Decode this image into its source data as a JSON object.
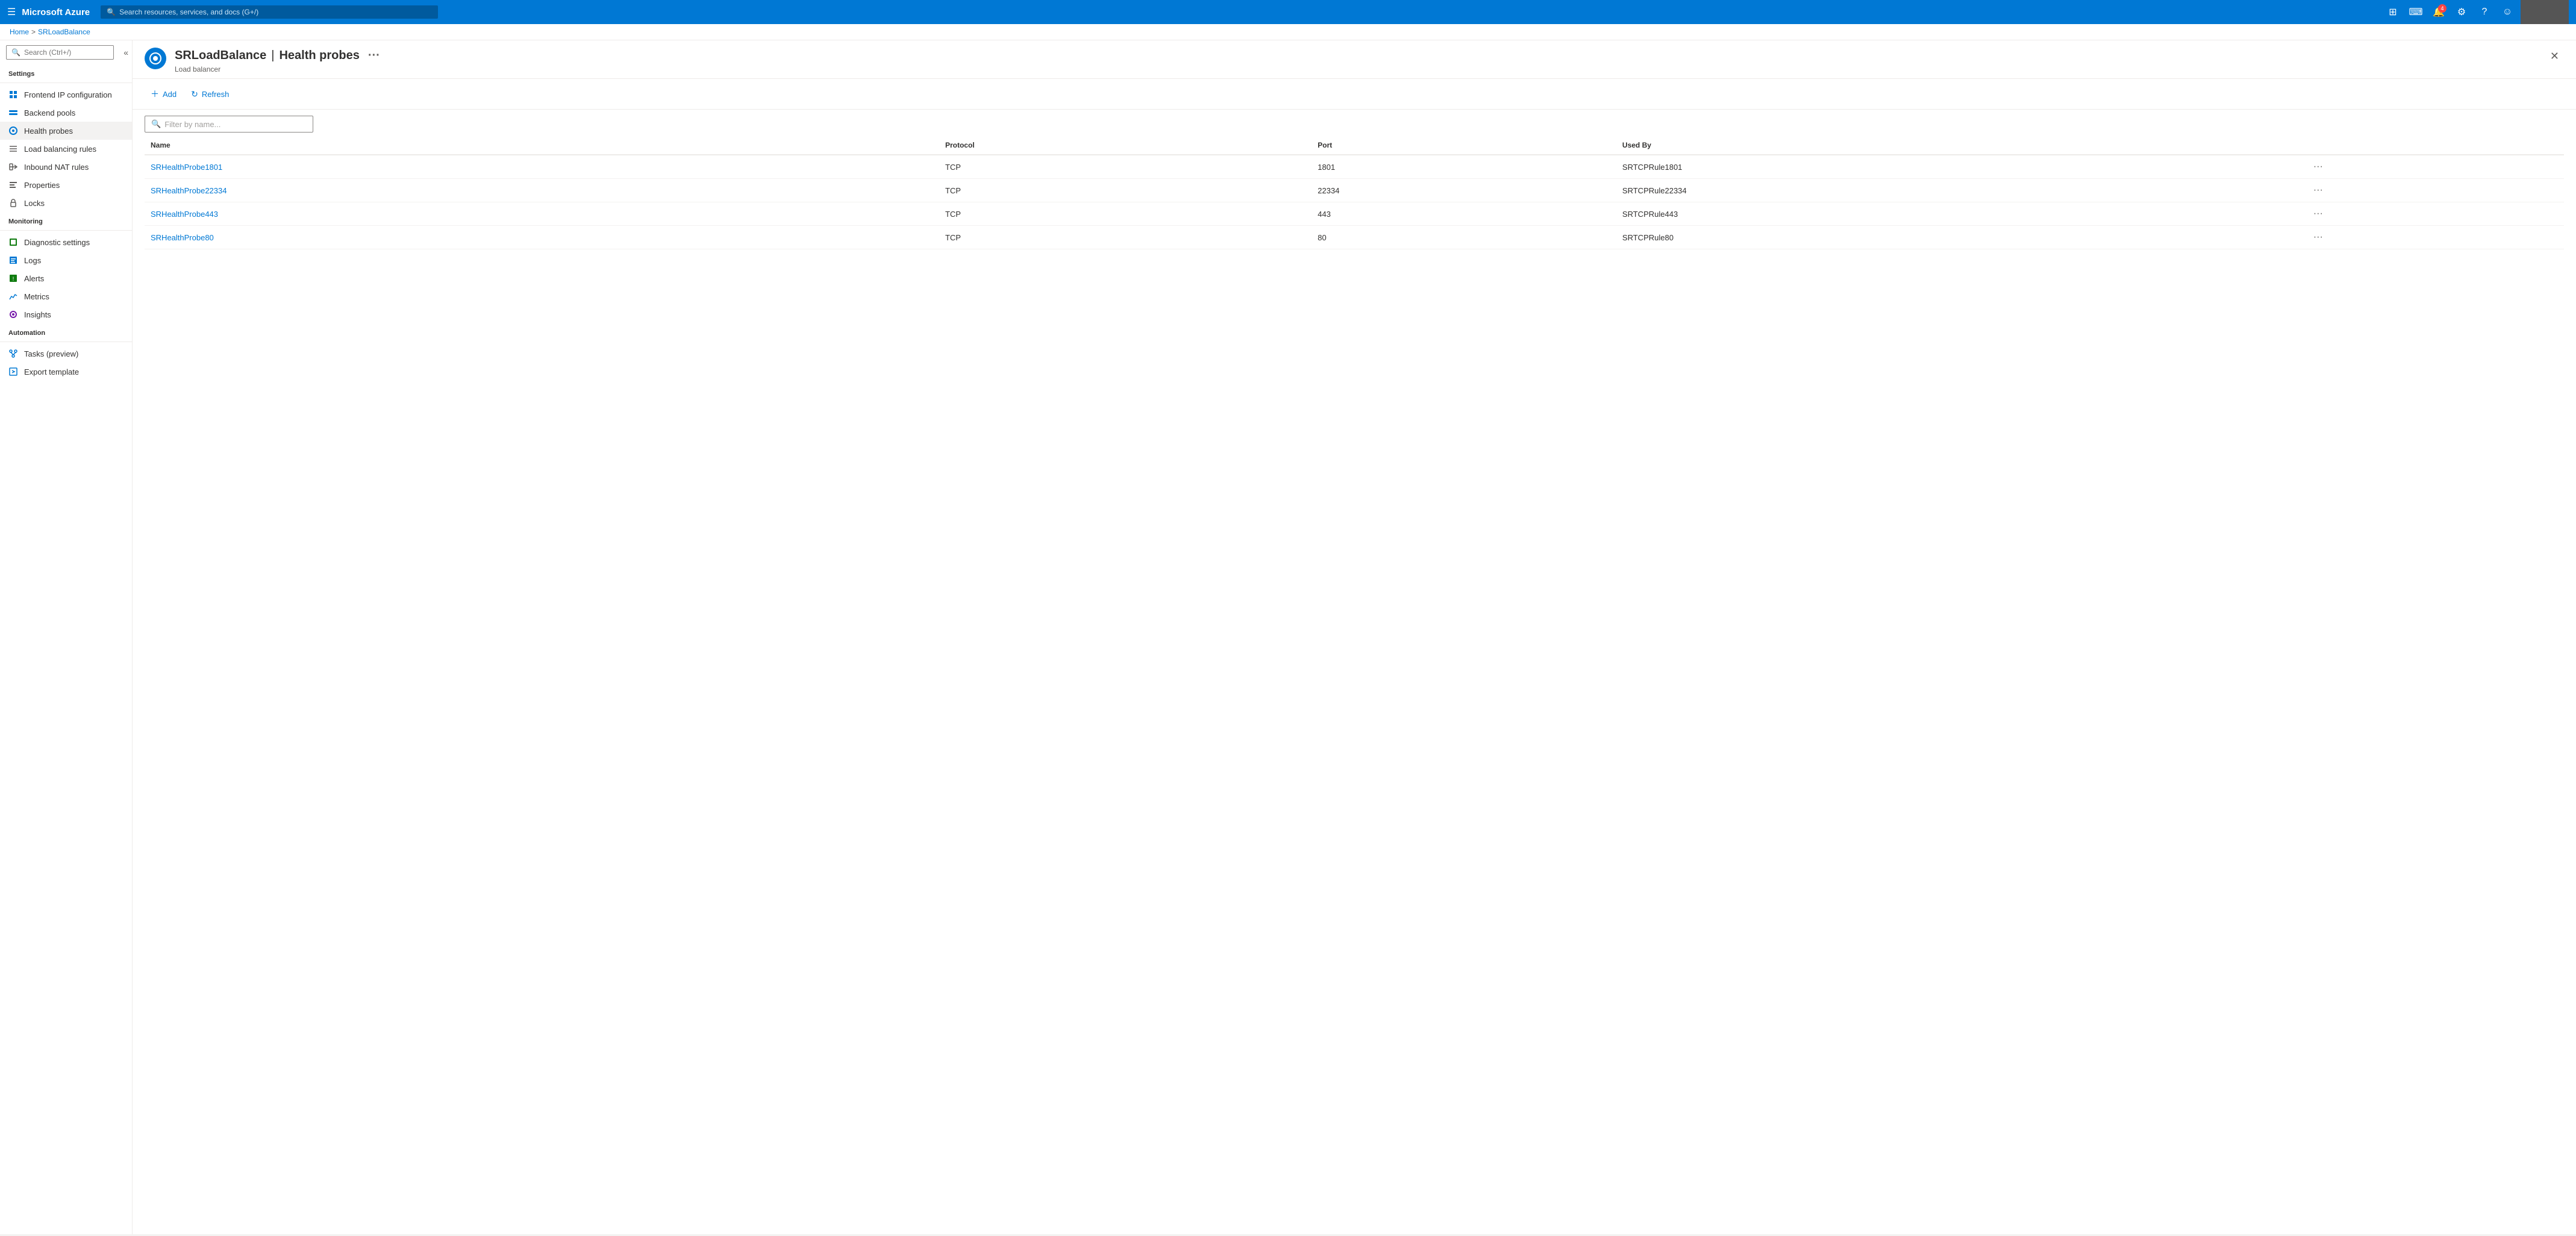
{
  "topNav": {
    "hamburger": "☰",
    "brand": "Microsoft Azure",
    "searchPlaceholder": "Search resources, services, and docs (G+/)",
    "notificationCount": "4",
    "icons": {
      "portal": "⊞",
      "cloud": "☁",
      "bell": "🔔",
      "gear": "⚙",
      "help": "?",
      "feedback": "☺"
    }
  },
  "breadcrumb": {
    "home": "Home",
    "resource": "SRLoadBalance",
    "separator": ">"
  },
  "resourceHeader": {
    "icon": "◎",
    "title": "SRLoadBalance",
    "pageTitle": "Health probes",
    "subtitle": "Load balancer",
    "menuDots": "···",
    "closeBtn": "✕"
  },
  "sidebar": {
    "searchPlaceholder": "Search (Ctrl+/)",
    "collapseBtn": "«",
    "sections": [
      {
        "label": "Settings",
        "items": [
          {
            "id": "frontend-ip",
            "label": "Frontend IP configuration",
            "icon": "grid"
          },
          {
            "id": "backend-pools",
            "label": "Backend pools",
            "icon": "pool"
          },
          {
            "id": "health-probes",
            "label": "Health probes",
            "icon": "probe",
            "active": true
          },
          {
            "id": "load-balancing-rules",
            "label": "Load balancing rules",
            "icon": "rules"
          },
          {
            "id": "inbound-nat-rules",
            "label": "Inbound NAT rules",
            "icon": "nat"
          },
          {
            "id": "properties",
            "label": "Properties",
            "icon": "properties"
          },
          {
            "id": "locks",
            "label": "Locks",
            "icon": "lock"
          }
        ]
      },
      {
        "label": "Monitoring",
        "items": [
          {
            "id": "diagnostic-settings",
            "label": "Diagnostic settings",
            "icon": "diagnostic"
          },
          {
            "id": "logs",
            "label": "Logs",
            "icon": "logs"
          },
          {
            "id": "alerts",
            "label": "Alerts",
            "icon": "alerts"
          },
          {
            "id": "metrics",
            "label": "Metrics",
            "icon": "metrics"
          },
          {
            "id": "insights",
            "label": "Insights",
            "icon": "insights"
          }
        ]
      },
      {
        "label": "Automation",
        "items": [
          {
            "id": "tasks",
            "label": "Tasks (preview)",
            "icon": "tasks"
          },
          {
            "id": "export-template",
            "label": "Export template",
            "icon": "export"
          }
        ]
      }
    ]
  },
  "toolbar": {
    "addLabel": "Add",
    "refreshLabel": "Refresh"
  },
  "filterInput": {
    "placeholder": "Filter by name..."
  },
  "table": {
    "columns": [
      "Name",
      "Protocol",
      "Port",
      "Used By"
    ],
    "rows": [
      {
        "name": "SRHealthProbe1801",
        "protocol": "TCP",
        "port": "1801",
        "usedBy": "SRTCPRule1801"
      },
      {
        "name": "SRHealthProbe22334",
        "protocol": "TCP",
        "port": "22334",
        "usedBy": "SRTCPRule22334"
      },
      {
        "name": "SRHealthProbe443",
        "protocol": "TCP",
        "port": "443",
        "usedBy": "SRTCPRule443"
      },
      {
        "name": "SRHealthProbe80",
        "protocol": "TCP",
        "port": "80",
        "usedBy": "SRTCPRule80"
      }
    ]
  }
}
